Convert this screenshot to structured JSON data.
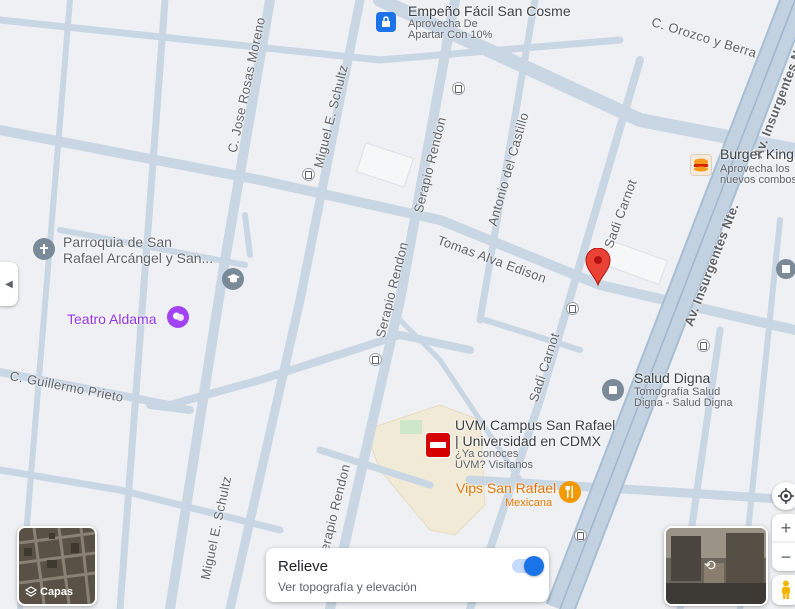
{
  "streets": {
    "orozco_berra": "C. Orozco y Berra",
    "rosas_moreno": "C. Jose Rosas Moreno",
    "schultz_top": "Miguel E. Schultz",
    "serapio_top": "Serapio Rendon",
    "castillo": "Antonio del Castillo",
    "sadi_top": "Sadi Carnot",
    "insurgentes_a": "Av. Insurgentes Nte.",
    "insurgentes_b": "Av. Insurgentes Nte.",
    "edison": "Tomas Alva Edison",
    "serapio_mid": "Serapio Rendon",
    "sadi_mid": "Sadi Carnot",
    "prieto": "C. Guillermo Prieto",
    "schultz_bottom": "Miguel E. Schultz",
    "serapio_bottom": "Serapio Rendon"
  },
  "places": {
    "empeno": {
      "name": "Empeño Fácil San Cosme",
      "sub1": "Aprovecha De",
      "sub2": "Apartar Con 10%",
      "icon": "lock-bag-icon",
      "color": "#1a73e8"
    },
    "burger": {
      "name": "Burger King",
      "sub1": "Aprovecha los",
      "sub2": "nuevos combos",
      "icon": "burger-king-logo",
      "color": "#d62300"
    },
    "parroquia": {
      "name1": "Parroquia de San",
      "name2": "Rafael Arcángel y San...",
      "icon": "cross-icon",
      "color": "#7b8a99"
    },
    "teatro": {
      "name": "Teatro Aldama",
      "icon": "theater-icon",
      "color": "#a142f4"
    },
    "salud": {
      "name": "Salud Digna",
      "sub1": "Tomografía Salud",
      "sub2": "Digna - Salud Digna",
      "icon": "medical-icon",
      "color": "#7b8a99"
    },
    "uvm": {
      "name1": "UVM Campus San Rafael",
      "name2": "| Universidad en CDMX",
      "sub1": "¿Ya conoces",
      "sub2": "UVM? Visitanos",
      "icon": "uvm-logo",
      "color": "#d50000"
    },
    "vips": {
      "name": "Vips San Rafael",
      "sub": "Mexicana",
      "icon": "fork-knife-icon",
      "color": "#f29900"
    }
  },
  "controls": {
    "layers_label": "Capas",
    "relief_title": "Relieve",
    "relief_sub": "Ver topografía y elevación",
    "relief_on": true,
    "zoom_in": "+",
    "zoom_out": "−"
  },
  "colors": {
    "accent": "#1a73e8",
    "marker": "#ea4335",
    "road": "#c5d3e0",
    "bg": "#eef0f3"
  }
}
